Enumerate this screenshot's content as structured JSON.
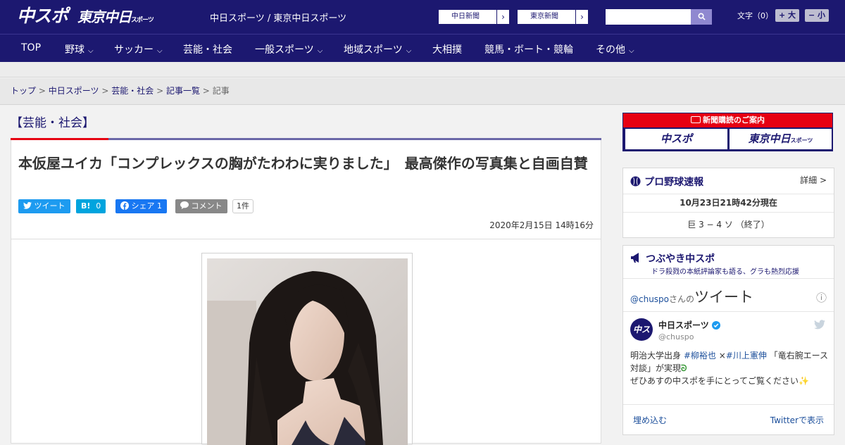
{
  "header": {
    "logo_chuspo": "中スポ",
    "logo_tokyo": "東京中日",
    "logo_tokyo_small": "スポーツ",
    "tagline": "中日スポーツ / 東京中日スポーツ",
    "newspaper_links": [
      "中日新聞",
      "東京新聞"
    ],
    "search_placeholder": "",
    "font_size_label": "文字（0）",
    "font_plus": "+ 大",
    "font_minus": "− 小"
  },
  "nav": {
    "items": [
      {
        "label": "TOP",
        "dropdown": false
      },
      {
        "label": "野球",
        "dropdown": true
      },
      {
        "label": "サッカー",
        "dropdown": true
      },
      {
        "label": "芸能・社会",
        "dropdown": false
      },
      {
        "label": "一般スポーツ",
        "dropdown": true
      },
      {
        "label": "地域スポーツ",
        "dropdown": true
      },
      {
        "label": "大相撲",
        "dropdown": false
      },
      {
        "label": "競馬・ボート・競輪",
        "dropdown": false
      },
      {
        "label": "その他",
        "dropdown": true
      }
    ]
  },
  "breadcrumb": {
    "items": [
      "トップ",
      "中日スポーツ",
      "芸能・社会",
      "記事一覧"
    ],
    "current": "記事",
    "separator": ">"
  },
  "article": {
    "category": "【芸能・社会】",
    "headline": "本仮屋ユイカ「コンプレックスの胸がたわわに実りました」　最高傑作の写真集と自画自賛",
    "share": {
      "tweet": "ツイート",
      "hatena_mark": "B!",
      "hatena_count": "0",
      "facebook": "シェア",
      "facebook_count": "1",
      "comment": "コメント",
      "comment_count": "1件"
    },
    "date": "2020年2月15日 14時16分"
  },
  "sidebar": {
    "subscribe": {
      "header": "新聞購読のご案内",
      "left": "中スポ",
      "right": "東京中日",
      "right_small": "スポーツ"
    },
    "baseball": {
      "title": "プロ野球速報",
      "detail": "詳細 >",
      "timestamp": "10月23日21時42分現在",
      "score": "巨 3 − 4 ソ （終了）"
    },
    "tsubuyaki": {
      "title": "つぶやき中スポ",
      "subtitle": "ドラ殺戮の本紙評論家も語る、グラも熱烈応援",
      "tweets_prefix": "@chuspo",
      "tweets_mid": "さんの",
      "tweets_label": "ツイート",
      "info_icon": "ⓘ",
      "account_name": "中日スポーツ",
      "account_handle": "@chuspo",
      "tweet_line1_a": "明治大学出身 ",
      "tweet_hash1": "#柳裕也",
      "tweet_line1_b": " ×",
      "tweet_hash2": "#川上憲伸",
      "tweet_line1_c": " 「竜右腕エース",
      "tweet_line2": "対談」が実現",
      "tweet_line3": "ぜひあすの中スポを手にとってご覧ください",
      "embed": "埋め込む",
      "view_on_twitter": "Twitterで表示"
    }
  },
  "colors": {
    "brand_navy": "#1c1870",
    "accent_red": "#e60012",
    "twitter": "#1d9bf0",
    "hatena": "#00a4de",
    "facebook": "#1877f2",
    "comment_gray": "#888888"
  }
}
